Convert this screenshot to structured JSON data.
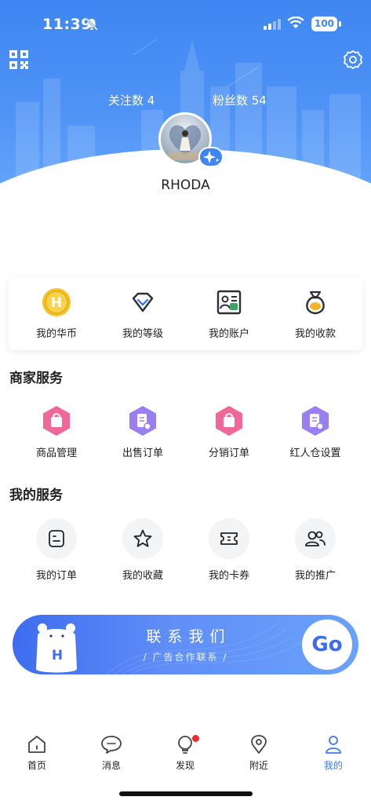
{
  "status_bar": {
    "time": "11:39",
    "battery": "100"
  },
  "profile": {
    "follow_text": "关注数 4",
    "fans_text": "粉丝数 54",
    "username": "RHODA"
  },
  "quick_actions": [
    {
      "label": "我的华币",
      "icon": "coin-icon"
    },
    {
      "label": "我的等级",
      "icon": "diamond-icon"
    },
    {
      "label": "我的账户",
      "icon": "account-card-icon"
    },
    {
      "label": "我的收款",
      "icon": "money-bag-icon"
    }
  ],
  "merchant_services": {
    "title": "商家服务",
    "items": [
      {
        "label": "商品管理",
        "icon": "bag-hexagon-icon"
      },
      {
        "label": "出售订单",
        "icon": "document-hexagon-icon"
      },
      {
        "label": "分销订单",
        "icon": "bag-hexagon-icon"
      },
      {
        "label": "红人仓设置",
        "icon": "document-hexagon-icon"
      }
    ]
  },
  "my_services": {
    "title": "我的服务",
    "items": [
      {
        "label": "我的订单",
        "icon": "order-icon"
      },
      {
        "label": "我的收藏",
        "icon": "star-icon"
      },
      {
        "label": "我的卡券",
        "icon": "ticket-icon"
      },
      {
        "label": "我的推广",
        "icon": "people-icon"
      }
    ]
  },
  "banner": {
    "title": "联系我们",
    "subtitle": "/ 广告合作联系 /",
    "go_label": "Go"
  },
  "tabs": [
    {
      "label": "首页",
      "icon": "home-icon"
    },
    {
      "label": "消息",
      "icon": "message-icon"
    },
    {
      "label": "发现",
      "icon": "bulb-icon"
    },
    {
      "label": "附近",
      "icon": "location-icon"
    },
    {
      "label": "我的",
      "icon": "person-icon",
      "active": true
    }
  ],
  "colors": {
    "brand_blue": "#3f86f2",
    "pink": "#f0689a",
    "purple": "#9a7ff0",
    "active_tab": "#3d7bf0"
  }
}
